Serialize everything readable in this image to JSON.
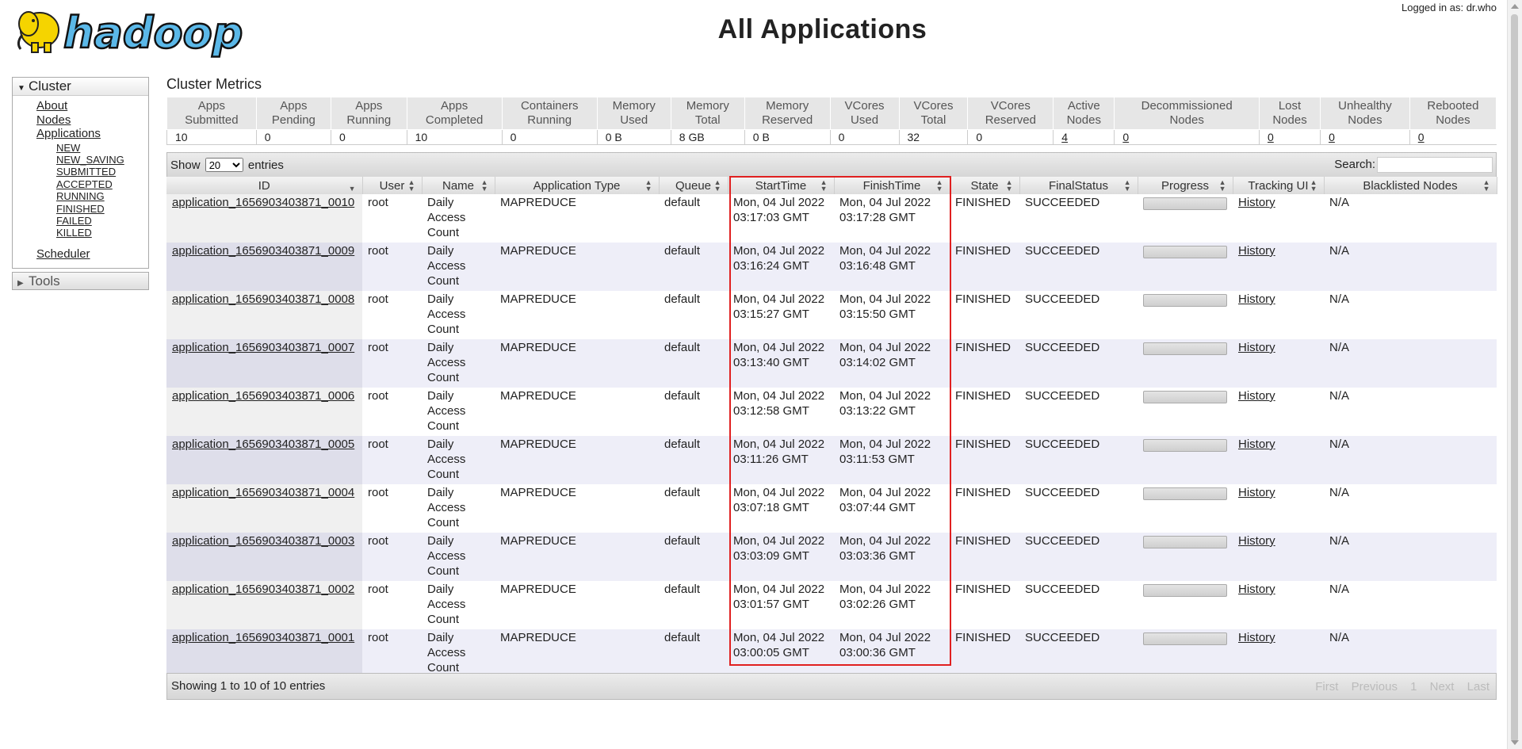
{
  "header": {
    "logo_text": "hadoop",
    "title": "All Applications",
    "logged_in": "Logged in as: dr.who"
  },
  "sidebar": {
    "cluster_label": "Cluster",
    "tools_label": "Tools",
    "links": [
      "About",
      "Nodes",
      "Applications"
    ],
    "app_states": [
      "NEW",
      "NEW_SAVING",
      "SUBMITTED",
      "ACCEPTED",
      "RUNNING",
      "FINISHED",
      "FAILED",
      "KILLED"
    ],
    "scheduler": "Scheduler"
  },
  "metrics": {
    "title": "Cluster Metrics",
    "headers": [
      [
        "Apps",
        "Submitted"
      ],
      [
        "Apps",
        "Pending"
      ],
      [
        "Apps",
        "Running"
      ],
      [
        "Apps",
        "Completed"
      ],
      [
        "Containers",
        "Running"
      ],
      [
        "Memory",
        "Used"
      ],
      [
        "Memory",
        "Total"
      ],
      [
        "Memory",
        "Reserved"
      ],
      [
        "VCores",
        "Used"
      ],
      [
        "VCores",
        "Total"
      ],
      [
        "VCores",
        "Reserved"
      ],
      [
        "Active",
        "Nodes"
      ],
      [
        "Decommissioned",
        "Nodes"
      ],
      [
        "Lost",
        "Nodes"
      ],
      [
        "Unhealthy",
        "Nodes"
      ],
      [
        "Rebooted",
        "Nodes"
      ]
    ],
    "values": [
      "10",
      "0",
      "0",
      "10",
      "0",
      "0 B",
      "8 GB",
      "0 B",
      "0",
      "32",
      "0",
      "4",
      "0",
      "0",
      "0",
      "0"
    ]
  },
  "table_controls": {
    "show_label": "Show",
    "entries_value": "20",
    "entries_label": "entries",
    "search_label": "Search:",
    "showing": "Showing 1 to 10 of 10 entries",
    "pager": [
      "First",
      "Previous",
      "1",
      "Next",
      "Last"
    ]
  },
  "apps": {
    "columns": [
      "ID",
      "User",
      "Name",
      "Application Type",
      "Queue",
      "StartTime",
      "FinishTime",
      "State",
      "FinalStatus",
      "Progress",
      "Tracking UI",
      "Blacklisted Nodes"
    ],
    "rows": [
      {
        "id": "application_1656903403871_0010",
        "user": "root",
        "name": "Daily Access Count",
        "type": "MAPREDUCE",
        "queue": "default",
        "start": "Mon, 04 Jul 2022 03:17:03 GMT",
        "finish": "Mon, 04 Jul 2022 03:17:28 GMT",
        "state": "FINISHED",
        "final": "SUCCEEDED",
        "progress": 100,
        "tracking": "History",
        "blacklisted": "N/A"
      },
      {
        "id": "application_1656903403871_0009",
        "user": "root",
        "name": "Daily Access Count",
        "type": "MAPREDUCE",
        "queue": "default",
        "start": "Mon, 04 Jul 2022 03:16:24 GMT",
        "finish": "Mon, 04 Jul 2022 03:16:48 GMT",
        "state": "FINISHED",
        "final": "SUCCEEDED",
        "progress": 100,
        "tracking": "History",
        "blacklisted": "N/A"
      },
      {
        "id": "application_1656903403871_0008",
        "user": "root",
        "name": "Daily Access Count",
        "type": "MAPREDUCE",
        "queue": "default",
        "start": "Mon, 04 Jul 2022 03:15:27 GMT",
        "finish": "Mon, 04 Jul 2022 03:15:50 GMT",
        "state": "FINISHED",
        "final": "SUCCEEDED",
        "progress": 100,
        "tracking": "History",
        "blacklisted": "N/A"
      },
      {
        "id": "application_1656903403871_0007",
        "user": "root",
        "name": "Daily Access Count",
        "type": "MAPREDUCE",
        "queue": "default",
        "start": "Mon, 04 Jul 2022 03:13:40 GMT",
        "finish": "Mon, 04 Jul 2022 03:14:02 GMT",
        "state": "FINISHED",
        "final": "SUCCEEDED",
        "progress": 100,
        "tracking": "History",
        "blacklisted": "N/A"
      },
      {
        "id": "application_1656903403871_0006",
        "user": "root",
        "name": "Daily Access Count",
        "type": "MAPREDUCE",
        "queue": "default",
        "start": "Mon, 04 Jul 2022 03:12:58 GMT",
        "finish": "Mon, 04 Jul 2022 03:13:22 GMT",
        "state": "FINISHED",
        "final": "SUCCEEDED",
        "progress": 100,
        "tracking": "History",
        "blacklisted": "N/A"
      },
      {
        "id": "application_1656903403871_0005",
        "user": "root",
        "name": "Daily Access Count",
        "type": "MAPREDUCE",
        "queue": "default",
        "start": "Mon, 04 Jul 2022 03:11:26 GMT",
        "finish": "Mon, 04 Jul 2022 03:11:53 GMT",
        "state": "FINISHED",
        "final": "SUCCEEDED",
        "progress": 100,
        "tracking": "History",
        "blacklisted": "N/A"
      },
      {
        "id": "application_1656903403871_0004",
        "user": "root",
        "name": "Daily Access Count",
        "type": "MAPREDUCE",
        "queue": "default",
        "start": "Mon, 04 Jul 2022 03:07:18 GMT",
        "finish": "Mon, 04 Jul 2022 03:07:44 GMT",
        "state": "FINISHED",
        "final": "SUCCEEDED",
        "progress": 100,
        "tracking": "History",
        "blacklisted": "N/A"
      },
      {
        "id": "application_1656903403871_0003",
        "user": "root",
        "name": "Daily Access Count",
        "type": "MAPREDUCE",
        "queue": "default",
        "start": "Mon, 04 Jul 2022 03:03:09 GMT",
        "finish": "Mon, 04 Jul 2022 03:03:36 GMT",
        "state": "FINISHED",
        "final": "SUCCEEDED",
        "progress": 100,
        "tracking": "History",
        "blacklisted": "N/A"
      },
      {
        "id": "application_1656903403871_0002",
        "user": "root",
        "name": "Daily Access Count",
        "type": "MAPREDUCE",
        "queue": "default",
        "start": "Mon, 04 Jul 2022 03:01:57 GMT",
        "finish": "Mon, 04 Jul 2022 03:02:26 GMT",
        "state": "FINISHED",
        "final": "SUCCEEDED",
        "progress": 100,
        "tracking": "History",
        "blacklisted": "N/A"
      },
      {
        "id": "application_1656903403871_0001",
        "user": "root",
        "name": "Daily Access Count",
        "type": "MAPREDUCE",
        "queue": "default",
        "start": "Mon, 04 Jul 2022 03:00:05 GMT",
        "finish": "Mon, 04 Jul 2022 03:00:36 GMT",
        "state": "FINISHED",
        "final": "SUCCEEDED",
        "progress": 100,
        "tracking": "History",
        "blacklisted": "N/A"
      }
    ]
  },
  "colors": {
    "highlight": "#e02020",
    "logo_blue": "#5bb8e8",
    "logo_yellow": "#f5d400"
  }
}
